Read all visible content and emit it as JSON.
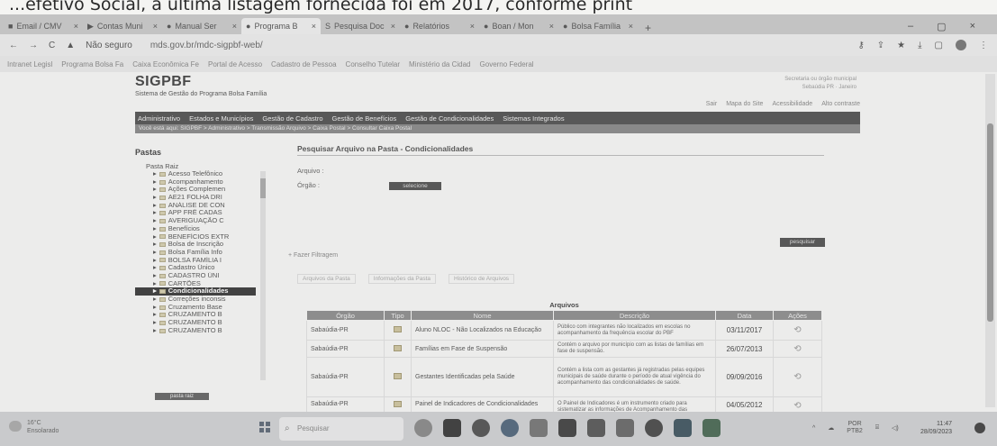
{
  "caption": "...efetivo Social, a última listagem fornecida foi em 2017, conforme print",
  "browser": {
    "tabs": [
      {
        "label": "Email / CMV"
      },
      {
        "label": "Contas Muni"
      },
      {
        "label": "Manual Ser"
      },
      {
        "label": "Programa B"
      },
      {
        "label": "Pesquisa Doc"
      },
      {
        "label": "Relatórios"
      },
      {
        "label": "Boan / Mon"
      },
      {
        "label": "Bolsa Família"
      }
    ],
    "new_tab": "+",
    "window_controls": {
      "minimize": "–",
      "maximize": "▢",
      "close": "×"
    },
    "nav": {
      "back": "←",
      "forward": "→",
      "reload": "C"
    },
    "address_security": "Não seguro",
    "address_url": "mds.gov.br/mdc-sigpbf-web/",
    "bookmarks": [
      "Intranet Legisl",
      "Programa Bolsa Fa",
      "Caixa Econômica Fe",
      "Portal de Acesso",
      "Cadastro de Pessoa",
      "Conselho Tutelar",
      "Ministério da Cidad",
      "Governo Federal"
    ]
  },
  "sigpbf": {
    "logo": "SIGPBF",
    "logo_sub": "Sistema de Gestão do Programa Bolsa Família",
    "header_right_1": "Secretaria ou órgão municipal",
    "header_right_2": "Sebaúdia PR · Janeiro",
    "top_links": [
      "Sair",
      "Mapa do Site",
      "Acessibilidade",
      "Alto contraste"
    ],
    "menu": [
      "Administrativo",
      "Estados e Municípios",
      "Gestão de Cadastro",
      "Gestão de Benefícios",
      "Gestão de Condicionalidades",
      "Sistemas Integrados"
    ],
    "breadcrumb": "Você está aqui: SIGPBF > Administrativo > Transmissão Arquivo > Caixa Postal > Consultar Caixa Postal",
    "sidebar": {
      "title": "Pastas",
      "root": "Pasta Raiz",
      "items": [
        "Acesso Telefônico",
        "Acompanhamento",
        "Ações Complemen",
        "AE21 FOLHA DRI",
        "ANÁLISE DE CON",
        "APP FRÊ CADAS",
        "AVERIGUAÇÃO C",
        "Benefícios",
        "BENEFÍCIOS EXTR",
        "Bolsa de Inscrição",
        "Bolsa Família Info",
        "BOLSA FAMÍLIA I",
        "Cadastro Único",
        "CADASTRO ÚNI",
        "CARTÕES",
        "Condicionalidades",
        "Correções inconsis",
        "Cruzamento Base",
        "CRUZAMENTO B",
        "CRUZAMENTO B",
        "CRUZAMENTO B"
      ],
      "selected_index": 15,
      "button": "pasta raiz"
    },
    "main": {
      "title": "Pesquisar Arquivo na Pasta - Condicionalidades",
      "arquivo_label": "Arquivo :",
      "orgao_label": "Órgão :",
      "select_button": "selecione",
      "search_button": "pesquisar",
      "filter_label": "+ Fazer Filtragem",
      "subtabs": [
        "Arquivos da Pasta",
        "Informações da Pasta",
        "Histórico de Arquivos"
      ],
      "table": {
        "caption": "Arquivos",
        "headers": [
          "Órgão",
          "Tipo",
          "Nome",
          "Descrição",
          "Data",
          "Ações"
        ],
        "rows": [
          {
            "orgao": "Sabaúdia-PR",
            "nome": "Aluno NLOC - Não Localizados na Educação",
            "descricao": "Público com integrantes não localizados em escolas no acompanhamento da frequência escolar do PBF",
            "data": "03/11/2017"
          },
          {
            "orgao": "Sabaúdia-PR",
            "nome": "Famílias em Fase de Suspensão",
            "descricao": "Contém o arquivo por município com as listas de famílias em fase de suspensão.",
            "data": "26/07/2013"
          },
          {
            "orgao": "Sabaúdia-PR",
            "nome": "Gestantes Identificadas pela Saúde",
            "descricao": "Contém a lista com as gestantes já registradas pelas equipes municipais de saúde durante o período de atual vigência do acompanhamento das condicionalidades de saúde.",
            "data": "09/09/2016"
          },
          {
            "orgao": "Sabaúdia-PR",
            "nome": "Painel de Indicadores de Condicionalidades",
            "descricao": "O Painel de Indicadores é um instrumento criado para sistematizar as informações de Acompanhamento das Condicionalidades e sinalizar as situações de vulnerabilidade enfrentadas pelas famílias do PBF",
            "data": "04/05/2012"
          }
        ]
      }
    }
  },
  "taskbar": {
    "weather_temp": "16°C",
    "weather_desc": "Ensolarado",
    "search_placeholder": "Pesquisar",
    "lang_1": "POR",
    "lang_2": "PTB2",
    "time": "11:47",
    "date": "28/09/2023"
  }
}
